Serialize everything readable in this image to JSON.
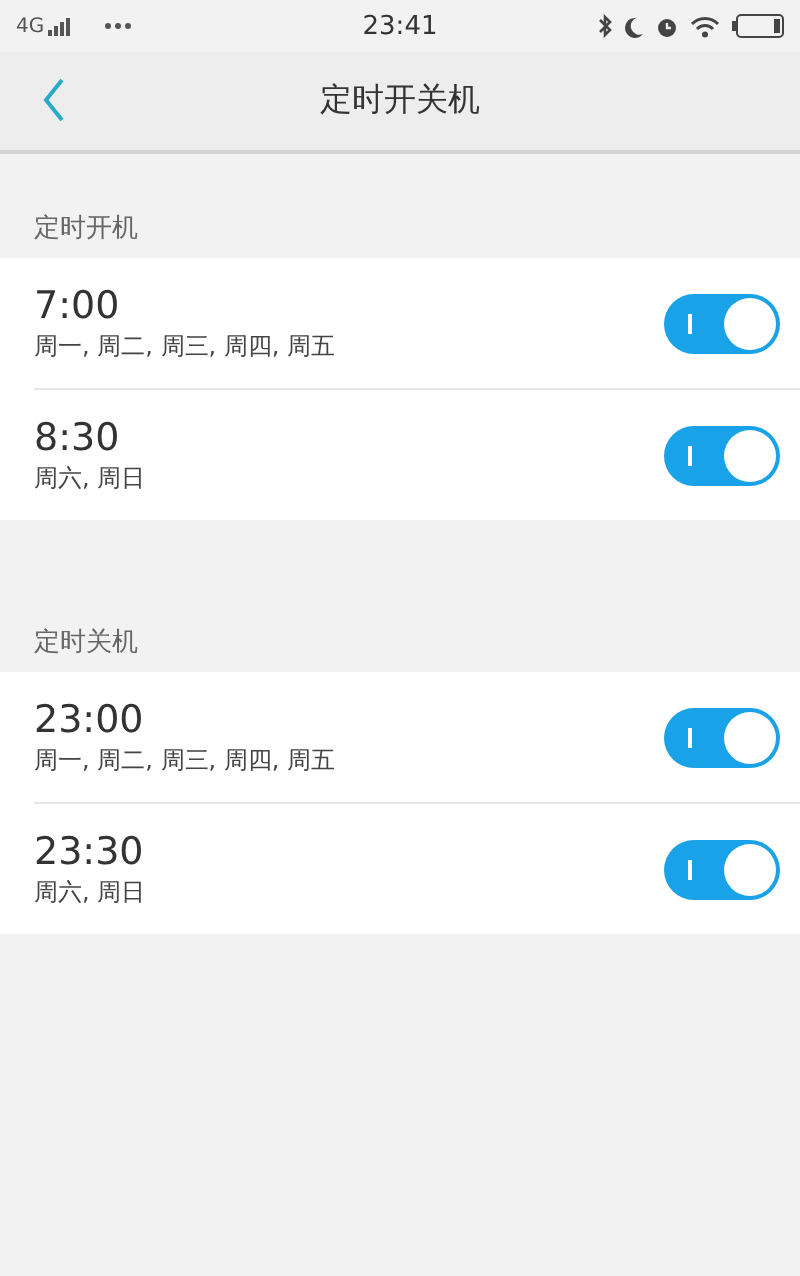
{
  "status_bar": {
    "network": "4G",
    "time": "23:41"
  },
  "nav": {
    "title": "定时开关机"
  },
  "sections": [
    {
      "title": "定时开机",
      "items": [
        {
          "time": "7:00",
          "days": "周一, 周二, 周三, 周四, 周五",
          "on": true
        },
        {
          "time": "8:30",
          "days": "周六, 周日",
          "on": true
        }
      ]
    },
    {
      "title": "定时关机",
      "items": [
        {
          "time": "23:00",
          "days": "周一, 周二, 周三, 周四, 周五",
          "on": true
        },
        {
          "time": "23:30",
          "days": "周六, 周日",
          "on": true
        }
      ]
    }
  ]
}
